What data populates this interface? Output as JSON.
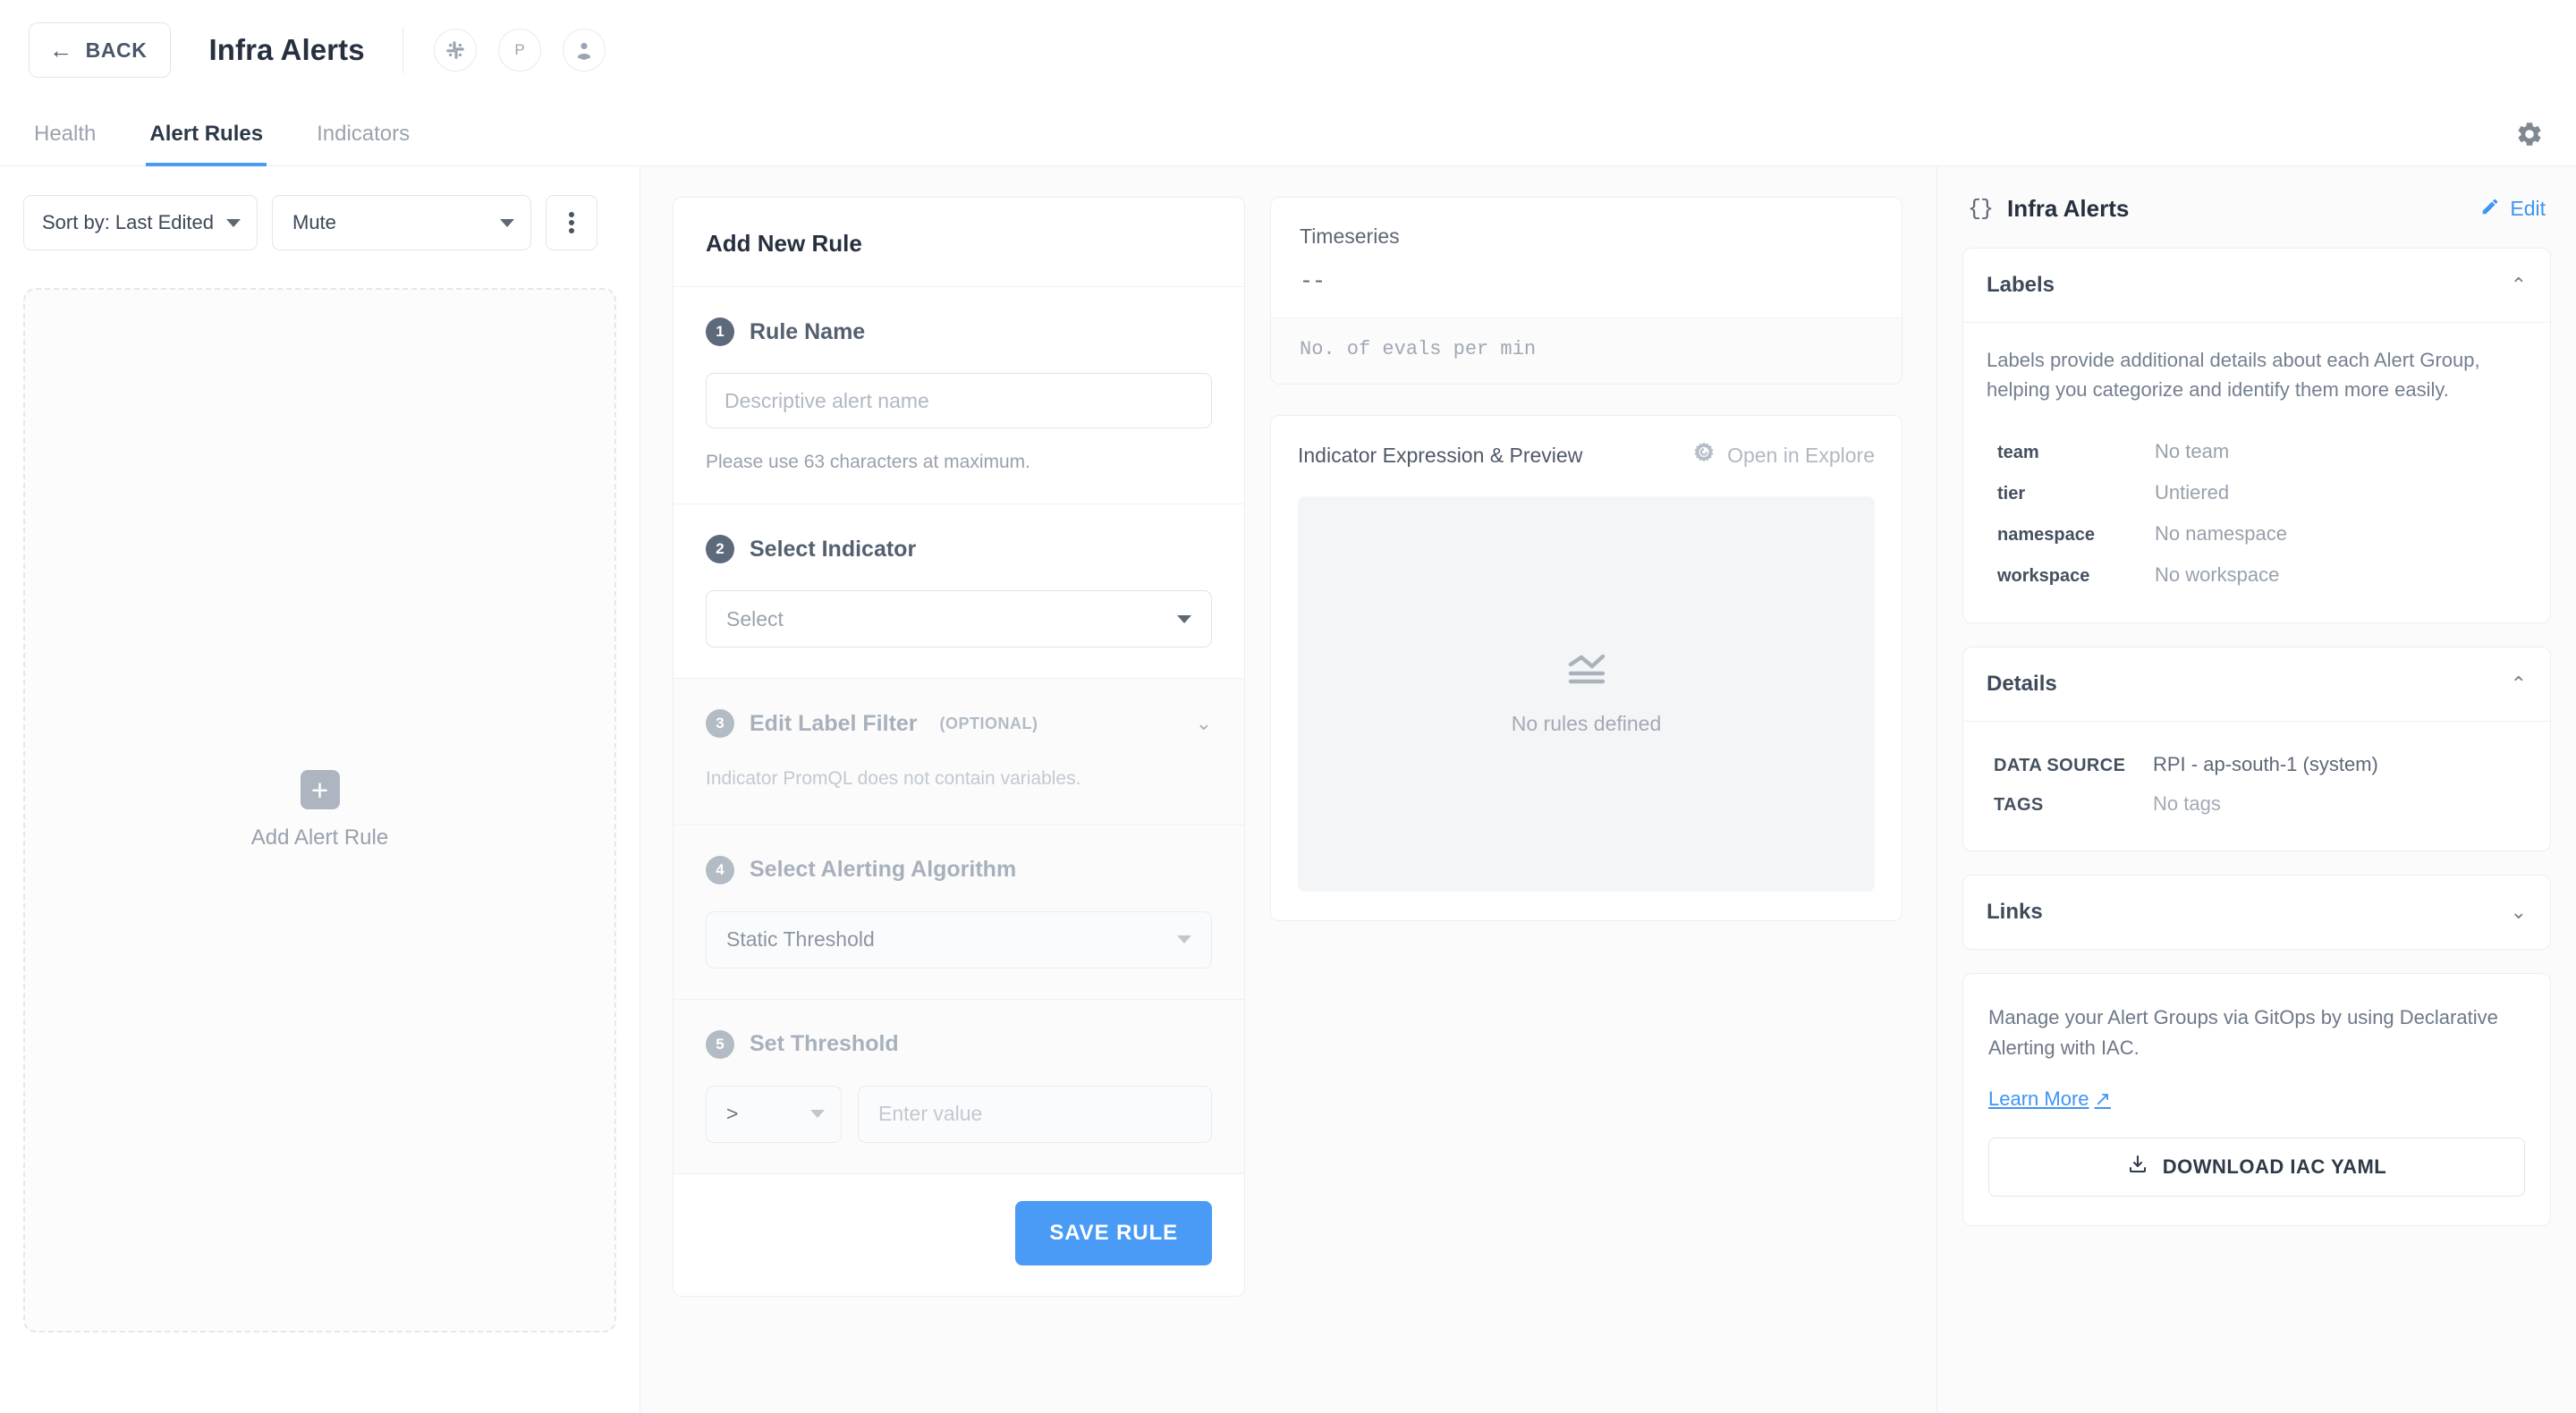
{
  "topbar": {
    "back_label": "BACK",
    "title": "Infra Alerts",
    "integrations": [
      {
        "name": "slack-icon",
        "label": "Slack"
      },
      {
        "name": "pagerduty-icon",
        "label": "P"
      },
      {
        "name": "user-assign-icon",
        "label": "Assignee"
      }
    ],
    "settings_label": "Settings"
  },
  "tabs": [
    {
      "label": "Health",
      "active": false
    },
    {
      "label": "Alert Rules",
      "active": true
    },
    {
      "label": "Indicators",
      "active": false
    }
  ],
  "left": {
    "sort_label": "Sort by: Last Edited",
    "mute_label": "Mute",
    "more_label": "More options",
    "empty_label": "Add Alert Rule"
  },
  "form": {
    "card_title": "Add New Rule",
    "steps": [
      {
        "num": "1",
        "label": "Rule Name"
      },
      {
        "num": "2",
        "label": "Select Indicator"
      },
      {
        "num": "3",
        "label": "Edit Label Filter"
      },
      {
        "num": "4",
        "label": "Select Alerting Algorithm"
      },
      {
        "num": "5",
        "label": "Set Threshold"
      }
    ],
    "rule_name_placeholder": "Descriptive alert name",
    "rule_name_value": "",
    "rule_name_helper": "Please use 63 characters at maximum.",
    "indicator_value": "Select",
    "label_filter_optional": "(OPTIONAL)",
    "label_filter_hint": "Indicator PromQL does not contain variables.",
    "algorithm_value": "Static Threshold",
    "threshold_operator": ">",
    "threshold_placeholder": "Enter value",
    "threshold_value": "",
    "save_label": "SAVE RULE"
  },
  "preview": {
    "timeseries_title": "Timeseries",
    "timeseries_value": "--",
    "evals_label": "No. of evals per min",
    "expression_title": "Indicator Expression & Preview",
    "explore_label": "Open in Explore",
    "empty_label": "No rules defined"
  },
  "right": {
    "group_title": "Infra Alerts",
    "edit_label": "Edit",
    "labels_panel": {
      "title": "Labels",
      "description": "Labels provide additional details about each Alert Group, helping you categorize and identify them more easily.",
      "items": [
        {
          "key": "team",
          "value": "No team"
        },
        {
          "key": "tier",
          "value": "Untiered"
        },
        {
          "key": "namespace",
          "value": "No namespace"
        },
        {
          "key": "workspace",
          "value": "No workspace"
        }
      ]
    },
    "details_panel": {
      "title": "Details",
      "rows": [
        {
          "key": "DATA SOURCE",
          "value": "RPI - ap-south-1 (system)",
          "muted": false
        },
        {
          "key": "TAGS",
          "value": "No tags",
          "muted": true
        }
      ]
    },
    "links_panel": {
      "title": "Links"
    },
    "gitops": {
      "text": "Manage your Alert Groups via GitOps by using Declarative Alerting with IAC.",
      "learn_more": "Learn More",
      "learn_more_arrow": "↗",
      "download_label": "DOWNLOAD IAC YAML"
    }
  },
  "colors": {
    "accent": "#4a9bf5",
    "link": "#3f95f3",
    "text_dark": "#27303f",
    "text_muted": "#98a1ac",
    "border": "#eceef1"
  }
}
